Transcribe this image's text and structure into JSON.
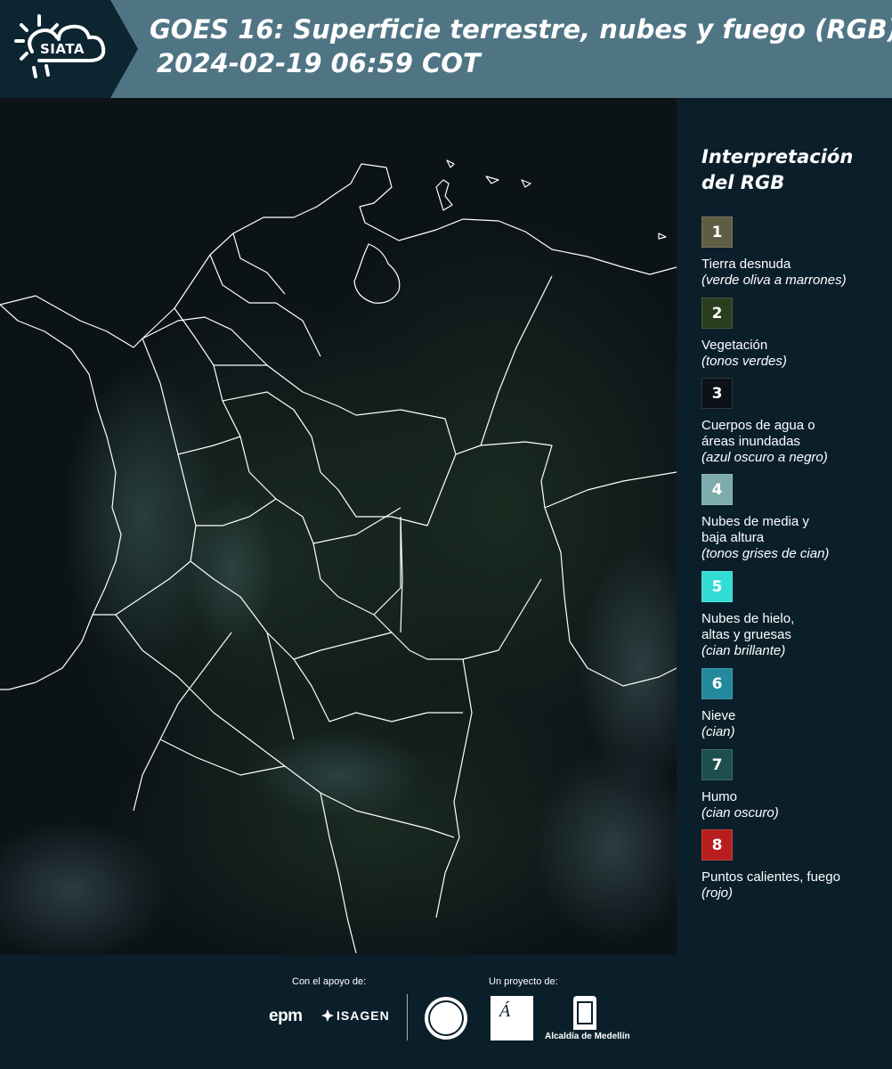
{
  "header": {
    "logo_text": "SIATA",
    "title_line1": "GOES 16: Superficie terrestre, nubes y fuego (RGB)",
    "title_line2": "2024-02-19 06:59 COT"
  },
  "legend": {
    "title_line1": "Interpretación",
    "title_line2": "del RGB",
    "items": [
      {
        "num": "1",
        "color": "#5e5e42",
        "label_lines": [
          "Tierra desnuda"
        ],
        "desc": "(verde oliva a marrones)"
      },
      {
        "num": "2",
        "color": "#2b3d1f",
        "label_lines": [
          "Vegetación"
        ],
        "desc": "(tonos verdes)"
      },
      {
        "num": "3",
        "color": "#0c1218",
        "label_lines": [
          "Cuerpos de agua o",
          "áreas inundadas"
        ],
        "desc": "(azul oscuro a negro)"
      },
      {
        "num": "4",
        "color": "#7eabab",
        "label_lines": [
          "Nubes de media y",
          "baja altura"
        ],
        "desc": "(tonos grises de cian)"
      },
      {
        "num": "5",
        "color": "#34dcd6",
        "label_lines": [
          "Nubes de hielo,",
          "altas y gruesas"
        ],
        "desc": "(cian brillante)"
      },
      {
        "num": "6",
        "color": "#23899c",
        "label_lines": [
          "Nieve"
        ],
        "desc": "(cian)"
      },
      {
        "num": "7",
        "color": "#1d4f4e",
        "label_lines": [
          "Humo"
        ],
        "desc": "(cian oscuro)"
      },
      {
        "num": "8",
        "color": "#b81e1e",
        "label_lines": [
          "Puntos calientes, fuego"
        ],
        "desc": "(rojo)"
      }
    ]
  },
  "footer": {
    "support_label": "Con el apoyo de:",
    "project_label": "Un proyecto de:",
    "sponsors": [
      "epm",
      "ISAGEN"
    ],
    "partners": [
      "Alcaldía de Medellín"
    ]
  },
  "colors": {
    "header_bg": "#4f7584",
    "logo_bg": "#0d2431",
    "page_bg": "#0b1f2b",
    "boundary": "#ffffff"
  }
}
